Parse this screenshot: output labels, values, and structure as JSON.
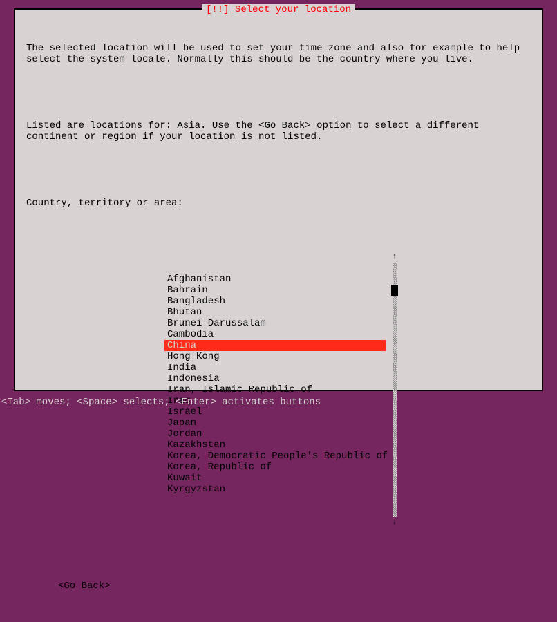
{
  "dialog": {
    "title": "[!!] Select your location",
    "desc_line1": "The selected location will be used to set your time zone and also for example to help select the system locale. Normally this should be the country where you live.",
    "desc_line2": "Listed are locations for: Asia. Use the <Go Back> option to select a different continent or region if your location is not listed.",
    "prompt": "Country, territory or area:",
    "go_back": "<Go Back>"
  },
  "list": {
    "selected_index": 6,
    "items": [
      "Afghanistan",
      "Bahrain",
      "Bangladesh",
      "Bhutan",
      "Brunei Darussalam",
      "Cambodia",
      "China",
      "Hong Kong",
      "India",
      "Indonesia",
      "Iran, Islamic Republic of",
      "Iraq",
      "Israel",
      "Japan",
      "Jordan",
      "Kazakhstan",
      "Korea, Democratic People's Republic of",
      "Korea, Republic of",
      "Kuwait",
      "Kyrgyzstan"
    ]
  },
  "status": "<Tab> moves; <Space> selects; <Enter> activates buttons"
}
